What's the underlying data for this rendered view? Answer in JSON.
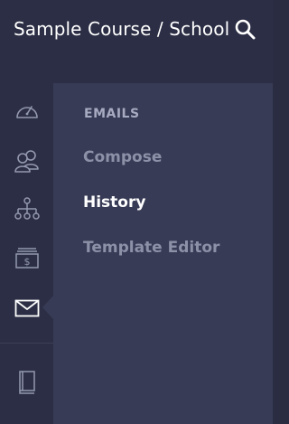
{
  "header": {
    "title": "Sample Course / School",
    "search_icon": "search-icon"
  },
  "rail": {
    "items": [
      {
        "name": "dashboard",
        "icon": "speedometer-icon"
      },
      {
        "name": "users",
        "icon": "users-icon"
      },
      {
        "name": "structure",
        "icon": "sitemap-icon"
      },
      {
        "name": "sales",
        "icon": "money-icon"
      },
      {
        "name": "emails",
        "icon": "envelope-icon",
        "active": true
      },
      {
        "name": "library",
        "icon": "book-icon"
      }
    ]
  },
  "panel": {
    "heading": "EMAILS",
    "links": [
      {
        "label": "Compose",
        "active": false
      },
      {
        "label": "History",
        "active": true
      },
      {
        "label": "Template Editor",
        "active": false
      }
    ]
  },
  "colors": {
    "rail_bg": "#2b2e44",
    "panel_bg": "#373b55",
    "icon": "#9498b0",
    "active_link": "#ffffff",
    "muted_link": "#8d91a8"
  }
}
